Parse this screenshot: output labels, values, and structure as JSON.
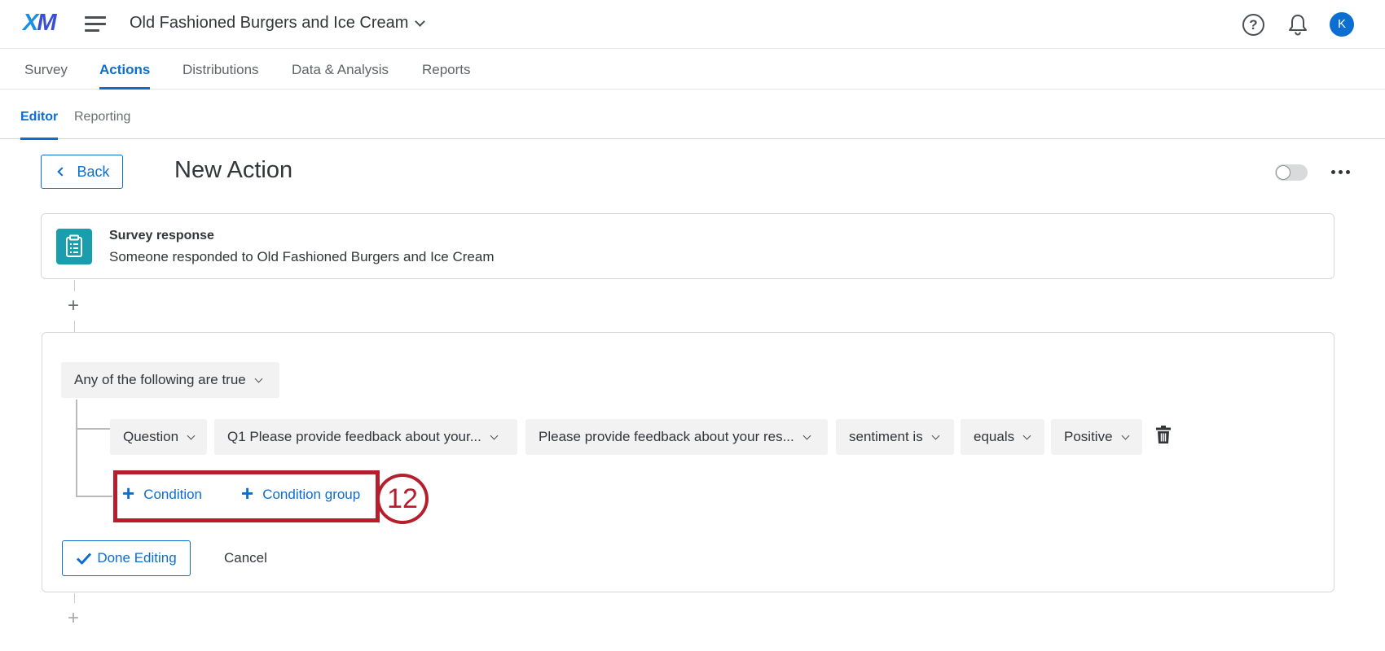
{
  "topbar": {
    "logo_x": "X",
    "logo_m": "M",
    "project_name": "Old Fashioned Burgers and Ice Cream",
    "help_glyph": "?",
    "avatar_initial": "K"
  },
  "main_nav": {
    "tabs": [
      {
        "label": "Survey",
        "active": false
      },
      {
        "label": "Actions",
        "active": true
      },
      {
        "label": "Distributions",
        "active": false
      },
      {
        "label": "Data & Analysis",
        "active": false
      },
      {
        "label": "Reports",
        "active": false
      }
    ]
  },
  "sub_nav": {
    "tabs": [
      {
        "label": "Editor",
        "active": true
      },
      {
        "label": "Reporting",
        "active": false
      }
    ]
  },
  "header": {
    "back_label": "Back",
    "title": "New Action",
    "toggle_on": false
  },
  "trigger": {
    "icon": "clipboard-icon",
    "title": "Survey response",
    "description": "Someone responded to Old Fashioned Burgers and Ice Cream"
  },
  "conditions": {
    "group_operator": "Any of the following are true",
    "rows": [
      {
        "type": "Question",
        "question": "Q1 Please provide feedback about your...",
        "field": "Please provide feedback about your res...",
        "metric": "sentiment is",
        "operator": "equals",
        "value": "Positive"
      }
    ],
    "add_condition_label": "Condition",
    "add_condition_group_label": "Condition group",
    "step_number": "12",
    "done_label": "Done Editing",
    "cancel_label": "Cancel"
  },
  "colors": {
    "accent": "#0b6ed0",
    "highlight": "#b81d2b",
    "trigger_icon_bg": "#1a9eae"
  }
}
